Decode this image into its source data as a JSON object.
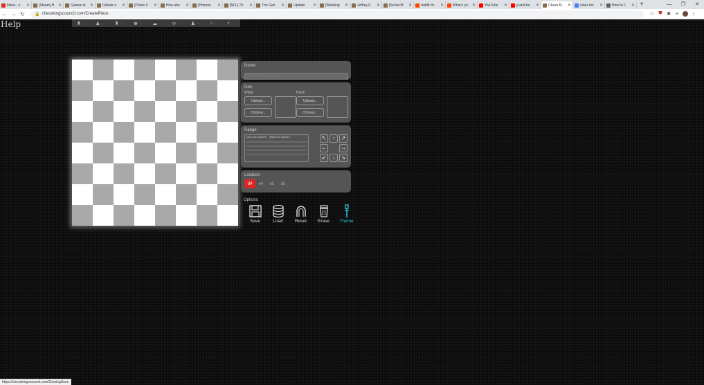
{
  "browser": {
    "tabs": [
      {
        "title": "Inbox - o",
        "favicon": "#d93025"
      },
      {
        "title": "[Steam] H",
        "favicon": "#8a6d4b"
      },
      {
        "title": "Games ar",
        "favicon": "#8a6d4b"
      },
      {
        "title": "Debate o",
        "favicon": "#8a6d4b"
      },
      {
        "title": "[Police S",
        "favicon": "#8a6d4b"
      },
      {
        "title": "How abo",
        "favicon": "#8a6d4b"
      },
      {
        "title": "[Homew",
        "favicon": "#8a6d4b"
      },
      {
        "title": "[NFL] Th",
        "favicon": "#8a6d4b"
      },
      {
        "title": "The Gen",
        "favicon": "#8a6d4b"
      },
      {
        "title": "Update:",
        "favicon": "#8a6d4b"
      },
      {
        "title": "[Washing",
        "favicon": "#8a6d4b"
      },
      {
        "title": "Jeffrey E",
        "favicon": "#8a6d4b"
      },
      {
        "title": "[Social M",
        "favicon": "#8a6d4b"
      },
      {
        "title": "reddit: th",
        "favicon": "#ff4500"
      },
      {
        "title": "What's yo",
        "favicon": "#ff4500"
      },
      {
        "title": "YouTube",
        "favicon": "#ff0000"
      },
      {
        "title": "g and bo",
        "favicon": "#ff0000"
      },
      {
        "title": "Chess Ki",
        "favicon": "#8a6d4b",
        "active": true
      },
      {
        "title": "silver kni",
        "favicon": "#4285f4"
      },
      {
        "title": "How to F",
        "favicon": "#5f6368"
      }
    ],
    "url": "chesskingscouncil.com/CreatePiece",
    "status_url": "https://chesskingscouncil.com/ComingSoon"
  },
  "page": {
    "help_label": "Help",
    "nav_items": [
      {
        "icon": "♜",
        "label": "·····"
      },
      {
        "icon": "♟",
        "label": "·····"
      },
      {
        "icon": "♜",
        "label": "·····"
      },
      {
        "icon": "♚",
        "label": "·····"
      },
      {
        "icon": "☁",
        "label": "·····"
      },
      {
        "icon": "♔",
        "label": "·····"
      },
      {
        "icon": "♟",
        "label": "·····"
      },
      {
        "icon": "⌂",
        "label": "·····"
      },
      {
        "icon": "◐",
        "label": "·····"
      }
    ],
    "board_colors": {
      "light": "#ffffff",
      "dark": "#a9a9a9"
    }
  },
  "name_panel": {
    "title": "Name",
    "placeholder": "Enter Name of piece..."
  },
  "icon_panel": {
    "title": "Icon",
    "white": {
      "label": "White",
      "upload": "Upload...",
      "choose": "Choose..."
    },
    "black": {
      "label": "Black",
      "upload": "Upload...",
      "choose": "Choose..."
    }
  },
  "range_panel": {
    "title": "Range",
    "col1": "jump over squares",
    "col2": "attack non-squares",
    "directions": [
      "↖",
      "↑",
      "↗",
      "←",
      "",
      "→",
      "↙",
      "↓",
      "↘"
    ]
  },
  "location_panel": {
    "title": "Location",
    "squares": [
      "d4",
      "e4",
      "e5",
      "d5"
    ],
    "selected": "d4",
    "selected_color": "#e02525"
  },
  "options_panel": {
    "title": "Options",
    "save": "Save",
    "load": "Load",
    "reset": "Reset",
    "erase": "Erase",
    "theme": "Theme",
    "theme_color": "#36c2d6"
  }
}
